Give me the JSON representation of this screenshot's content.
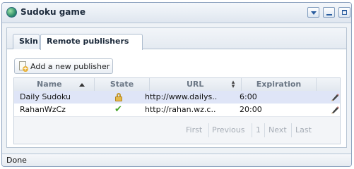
{
  "window": {
    "title": "Sudoku game",
    "app_icon": "globe-icon"
  },
  "tabs": [
    {
      "label": "Skin"
    },
    {
      "label": "Remote publishers"
    }
  ],
  "toolbar": {
    "add_label": "Add a new publisher",
    "add_icon": "add-document-icon"
  },
  "grid": {
    "columns": [
      "Name",
      "State",
      "URL",
      "Expiration"
    ],
    "rows": [
      {
        "name": "Daily Sudoku",
        "state_icon": "lock-icon",
        "url": "http://www.dailys..",
        "expiration": "6:00",
        "action_icon": "pencil-icon"
      },
      {
        "name": "RahanWzCz",
        "state_icon": "check-icon",
        "url": "http://rahan.wz.c..",
        "expiration": "20:00",
        "action_icon": "pencil-icon"
      }
    ],
    "pager": {
      "first": "First",
      "previous": "Previous",
      "page": "1",
      "next": "Next",
      "last": "Last"
    }
  },
  "status": {
    "text": "Done"
  },
  "colors": {
    "selected_row": "#dfe5f7",
    "check": "#4aa52e",
    "lock": "#e5b94a"
  }
}
